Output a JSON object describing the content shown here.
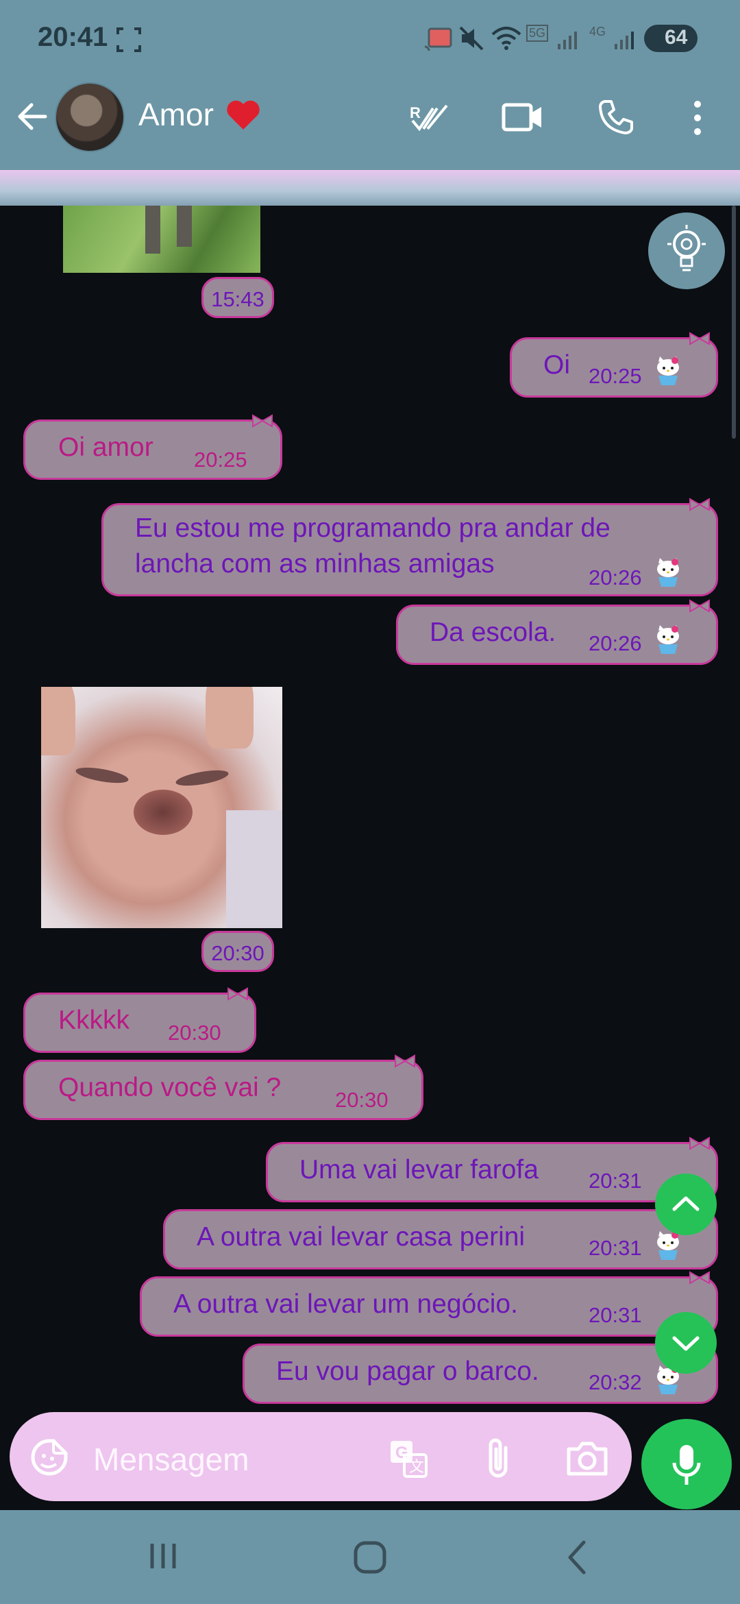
{
  "status_bar": {
    "time": "20:41",
    "network": "5G",
    "network2": "4G",
    "battery": "64"
  },
  "header": {
    "contact_name": "Amor"
  },
  "messages": [
    {
      "side": "in",
      "text": "Oi amor",
      "time": "20:25"
    },
    {
      "side": "out",
      "text": "Oi",
      "time": "20:25"
    },
    {
      "side": "out",
      "line1": "Eu estou me programando pra andar de",
      "line2": "lancha com as minhas amigas",
      "time": "20:26"
    },
    {
      "side": "out",
      "text": "Da escola.",
      "time": "20:26"
    },
    {
      "side": "in",
      "text": "Kkkkk",
      "time": "20:30"
    },
    {
      "side": "in",
      "text": "Quando você vai ?",
      "time": "20:30"
    },
    {
      "side": "out",
      "text": "Uma vai levar farofa",
      "time": "20:31"
    },
    {
      "side": "out",
      "text": "A outra vai levar casa perini",
      "time": "20:31"
    },
    {
      "side": "out",
      "text": "A outra vai levar um negócio.",
      "time": "20:31"
    },
    {
      "side": "out",
      "text": "Eu vou pagar o barco.",
      "time": "20:32"
    }
  ],
  "media": [
    {
      "kind": "image",
      "time": "15:43"
    },
    {
      "kind": "sticker",
      "time": "20:30"
    }
  ],
  "composer": {
    "placeholder": "Mensagem"
  },
  "colors": {
    "bar": "#6c96a5",
    "chat_bg": "#0b0e12",
    "bubble": "#9a8a99",
    "bubble_border": "#c8399b",
    "incoming_text": "#ba1a86",
    "outgoing_text": "#6d16b8",
    "fab_green": "#26c257",
    "composer_bg": "#edc5ee"
  }
}
